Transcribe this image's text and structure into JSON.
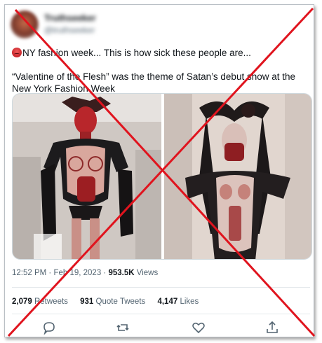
{
  "tweet": {
    "author_name": "Truthseeker",
    "author_handle": "@truthseeker",
    "line1": "NY fashion week... This is how sick these people are...",
    "line2": "“Valentine of the Flesh” was the theme of Satan’s debut show at the New York Fashion Week",
    "timestamp": "12:52 PM · Feb 19, 2023 · ",
    "views_count": "953.5K",
    "views_label": " Views"
  },
  "stats": {
    "retweets": {
      "count": "2,079",
      "label": "Retweets"
    },
    "quotes": {
      "count": "931",
      "label": "Quote Tweets"
    },
    "likes": {
      "count": "4,147",
      "label": "Likes"
    }
  },
  "actions": [
    "reply-icon",
    "retweet-icon",
    "like-icon",
    "share-icon"
  ],
  "colors": {
    "cross": "#e0141e",
    "text": "#0f1419",
    "muted": "#536471",
    "border": "#cfd9de"
  }
}
